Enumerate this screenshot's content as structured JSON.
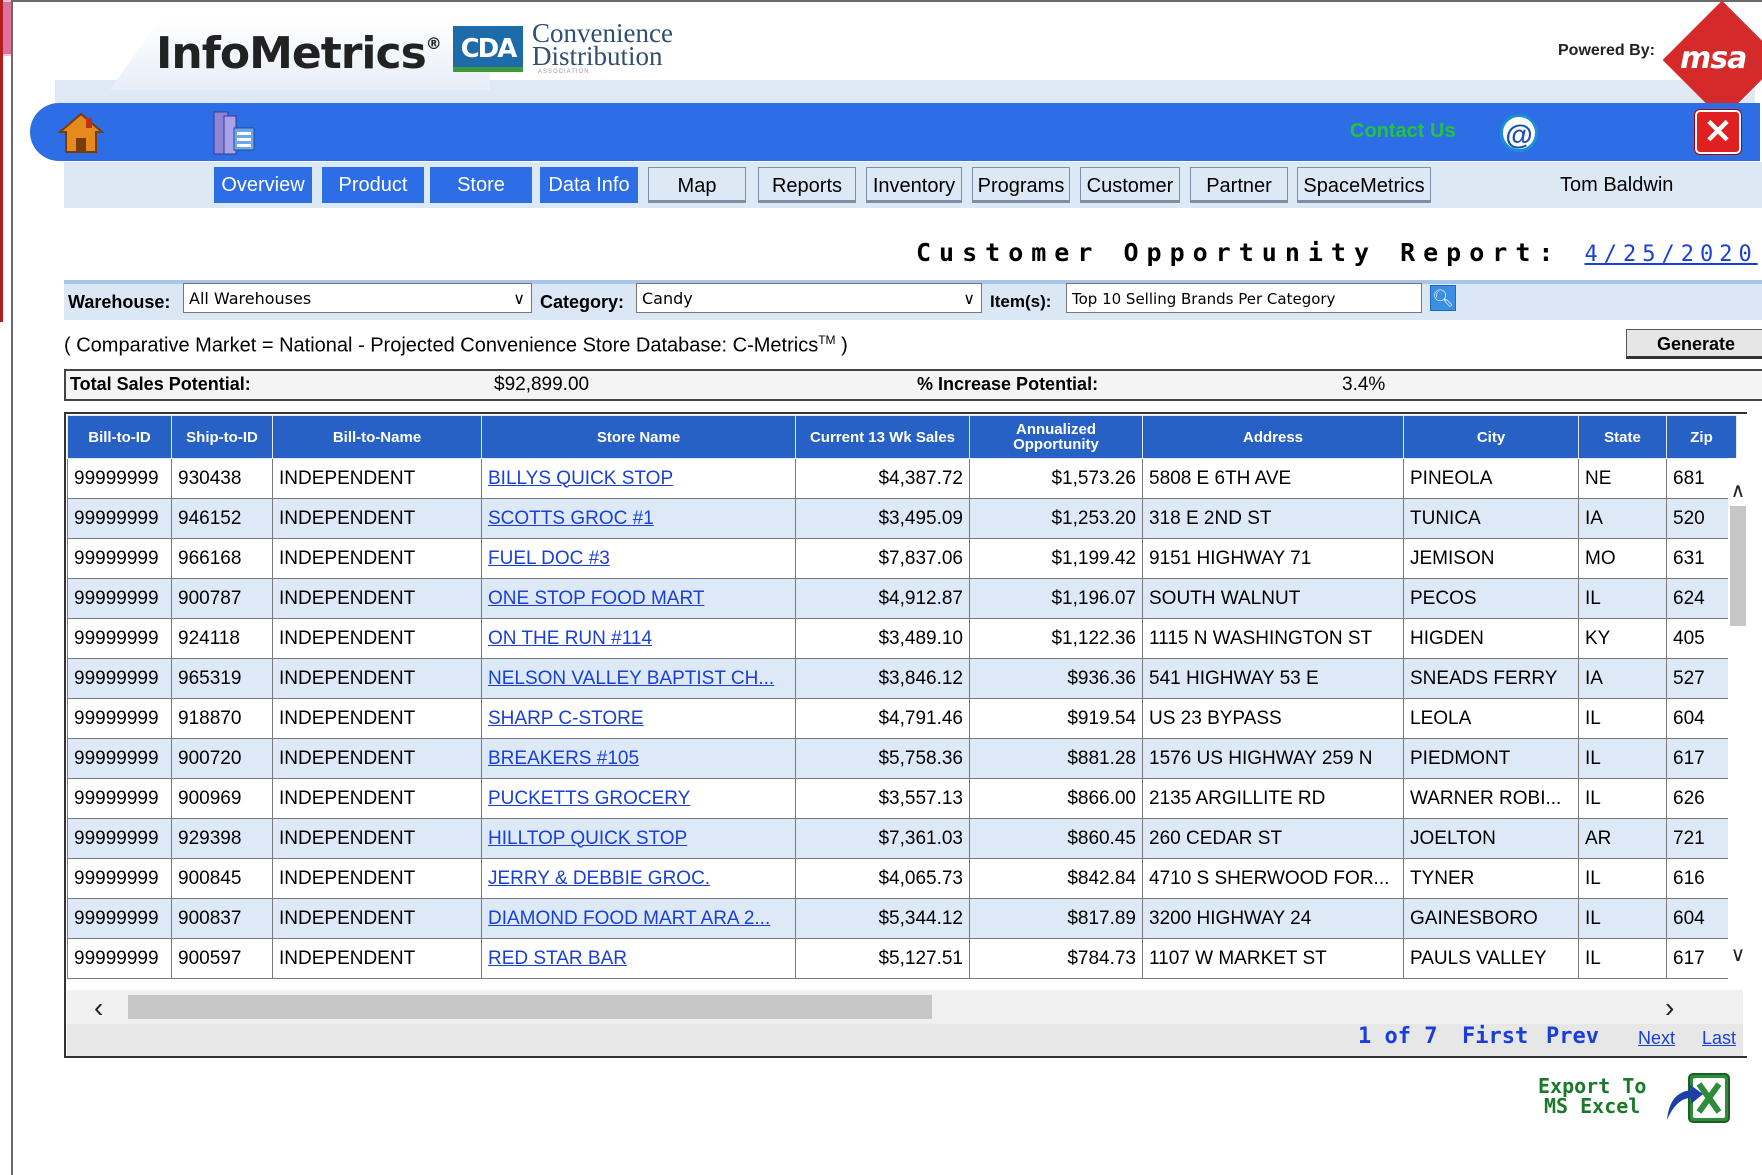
{
  "header": {
    "app_name": "InfoMetrics",
    "registered": "®",
    "partner_abbr": "CDA",
    "partner_name_line1": "Convenience",
    "partner_name_line2": "Distribution",
    "partner_tagline": "ASSOCIATION",
    "powered_by": "Powered By:",
    "vendor_logo_text": "msa"
  },
  "toolbar": {
    "contact_us": "Contact Us",
    "at_symbol": "@",
    "close_symbol": "✕"
  },
  "nav": {
    "tabs": [
      "Overview",
      "Product",
      "Store",
      "Data Info",
      "Map",
      "Reports",
      "Inventory",
      "Programs",
      "Customer",
      "Partner",
      "SpaceMetrics"
    ],
    "user_name": "Tom Baldwin"
  },
  "report": {
    "title": "Customer Opportunity Report:",
    "date": "4/25/2020"
  },
  "filters": {
    "warehouse_label": "Warehouse:",
    "warehouse_value": "All Warehouses",
    "category_label": "Category:",
    "category_value": "Candy",
    "items_label": "Item(s):",
    "items_value": "Top 10 Selling Brands Per Category"
  },
  "market_note": {
    "text": "( Comparative Market = National - Projected Convenience Store Database: C-Metrics",
    "tm": "TM",
    "close": " )"
  },
  "generate_label": "Generate",
  "totals": {
    "sales_label": "Total Sales Potential:",
    "sales_value": "$92,899.00",
    "increase_label": "% Increase Potential:",
    "increase_value": "3.4%"
  },
  "grid": {
    "columns": [
      "Bill-to-ID",
      "Ship-to-ID",
      "Bill-to-Name",
      "Store Name",
      "Current 13 Wk Sales",
      "Annualized Opportunity",
      "Address",
      "City",
      "State",
      "Zip"
    ],
    "rows": [
      [
        "99999999",
        "930438",
        "INDEPENDENT",
        "BILLYS QUICK STOP",
        "$4,387.72",
        "$1,573.26",
        "5808 E 6TH AVE",
        "PINEOLA",
        "NE",
        "681"
      ],
      [
        "99999999",
        "946152",
        "INDEPENDENT",
        "SCOTTS GROC #1",
        "$3,495.09",
        "$1,253.20",
        "318 E 2ND ST",
        "TUNICA",
        "IA",
        "520"
      ],
      [
        "99999999",
        "966168",
        "INDEPENDENT",
        "FUEL DOC #3",
        "$7,837.06",
        "$1,199.42",
        "9151 HIGHWAY 71",
        "JEMISON",
        "MO",
        "631"
      ],
      [
        "99999999",
        "900787",
        "INDEPENDENT",
        "ONE STOP FOOD MART",
        "$4,912.87",
        "$1,196.07",
        "SOUTH WALNUT",
        "PECOS",
        "IL",
        "624"
      ],
      [
        "99999999",
        "924118",
        "INDEPENDENT",
        "ON THE RUN #114",
        "$3,489.10",
        "$1,122.36",
        "1115 N WASHINGTON ST",
        "HIGDEN",
        "KY",
        "405"
      ],
      [
        "99999999",
        "965319",
        "INDEPENDENT",
        "NELSON VALLEY BAPTIST CH...",
        "$3,846.12",
        "$936.36",
        "541 HIGHWAY 53 E",
        "SNEADS FERRY",
        "IA",
        "527"
      ],
      [
        "99999999",
        "918870",
        "INDEPENDENT",
        "SHARP C-STORE",
        "$4,791.46",
        "$919.54",
        "US 23 BYPASS",
        "LEOLA",
        "IL",
        "604"
      ],
      [
        "99999999",
        "900720",
        "INDEPENDENT",
        "BREAKERS #105",
        "$5,758.36",
        "$881.28",
        "1576 US HIGHWAY 259 N",
        "PIEDMONT",
        "IL",
        "617"
      ],
      [
        "99999999",
        "900969",
        "INDEPENDENT",
        "PUCKETTS GROCERY",
        "$3,557.13",
        "$866.00",
        "2135 ARGILLITE RD",
        "WARNER ROBI...",
        "IL",
        "626"
      ],
      [
        "99999999",
        "929398",
        "INDEPENDENT",
        "HILLTOP QUICK STOP",
        "$7,361.03",
        "$860.45",
        "260 CEDAR ST",
        "JOELTON",
        "AR",
        "721"
      ],
      [
        "99999999",
        "900845",
        "INDEPENDENT",
        "JERRY & DEBBIE GROC.",
        "$4,065.73",
        "$842.84",
        "4710 S SHERWOOD FOR...",
        "TYNER",
        "IL",
        "616"
      ],
      [
        "99999999",
        "900837",
        "INDEPENDENT",
        "DIAMOND FOOD MART ARA 2...",
        "$5,344.12",
        "$817.89",
        "3200 HIGHWAY 24",
        "GAINESBORO",
        "IL",
        "604"
      ],
      [
        "99999999",
        "900597",
        "INDEPENDENT",
        "RED STAR BAR",
        "$5,127.51",
        "$784.73",
        "1107 W MARKET ST",
        "PAULS VALLEY",
        "IL",
        "617"
      ]
    ]
  },
  "pager": {
    "page_info": "1 of 7",
    "first": "First",
    "prev": "Prev",
    "next": "Next",
    "last": "Last"
  },
  "export": {
    "line1": "Export To",
    "line2": "MS Excel"
  },
  "colors": {
    "toolbar_blue": "#2d6ee6",
    "header_blue": "#2761c6",
    "link_blue": "#1a3fd8",
    "alt_row": "#dde9f7",
    "contact_green": "#22c43c",
    "close_red": "#e02020"
  }
}
